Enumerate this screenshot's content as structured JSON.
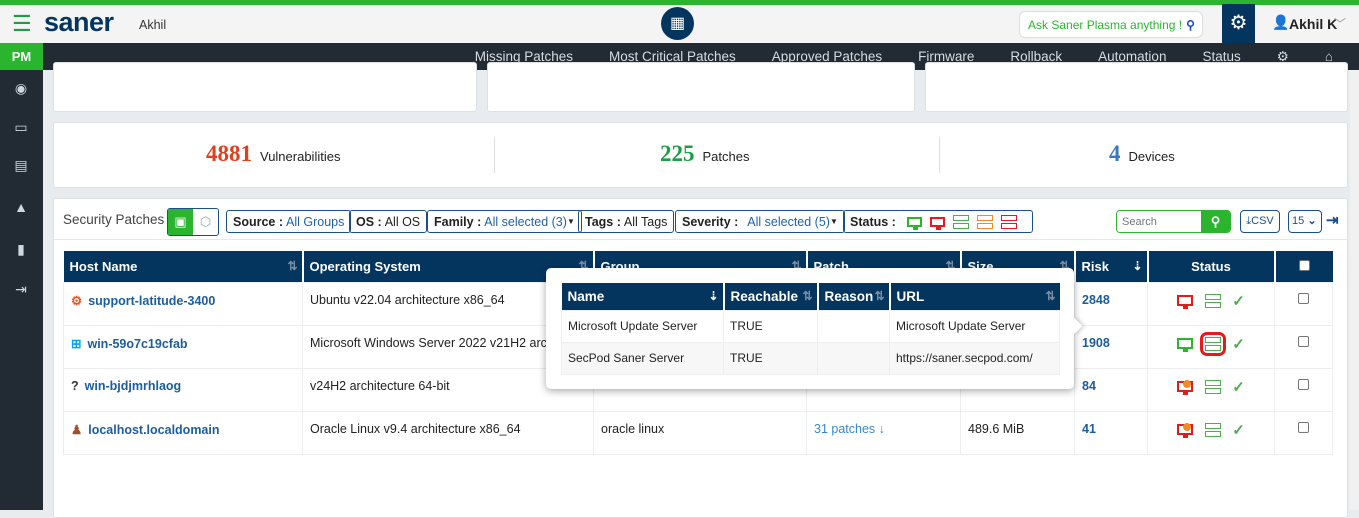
{
  "header": {
    "logo": "saner",
    "account": "Akhil",
    "ask": "Ask Saner Plasma anything !",
    "user": "Akhil K"
  },
  "nav": {
    "module": "PM",
    "items": [
      "Missing Patches",
      "Most Critical Patches",
      "Approved Patches",
      "Firmware",
      "Rollback",
      "Automation",
      "Status"
    ]
  },
  "stats": [
    {
      "value": "4881",
      "label": "Vulnerabilities",
      "color": "#e0401f"
    },
    {
      "value": "225",
      "label": "Patches",
      "color": "#1d9d47"
    },
    {
      "value": "4",
      "label": "Devices",
      "color": "#3a79c0"
    }
  ],
  "toolbar": {
    "title": "Security Patches",
    "source_label": "Source :",
    "source_value": "All Groups",
    "os_label": "OS :",
    "os_value": "All OS",
    "family_label": "Family :",
    "family_value": "All selected (3)",
    "tags_label": "Tags :",
    "tags_value": "All Tags",
    "severity_label": "Severity :",
    "severity_value": "All selected (5)",
    "status_label": "Status :",
    "search_placeholder": "Search",
    "csv": "CSV",
    "page_size": "15"
  },
  "table": {
    "headers": [
      "Host Name",
      "Operating System",
      "Group",
      "Patch",
      "Size",
      "Risk",
      "Status"
    ],
    "rows": [
      {
        "host": "support-latitude-3400",
        "os": "Ubuntu v22.04 architecture x86_64",
        "group": "",
        "patch": "",
        "size": "",
        "risk": "2848",
        "device": "red"
      },
      {
        "host": "win-59o7c19cfab",
        "os": "Microsoft Windows Server 2022 v21H2 architecture",
        "group": "",
        "patch": "",
        "size": "",
        "risk": "1908",
        "device": "green"
      },
      {
        "host": "win-bjdjmrhlaog",
        "os": "v24H2 architecture 64-bit",
        "group": "",
        "patch": "",
        "size": "",
        "risk": "84",
        "device": "warn"
      },
      {
        "host": "localhost.localdomain",
        "os": "Oracle Linux v9.4 architecture x86_64",
        "group": "oracle linux",
        "patch": "31 patches",
        "size": "489.6 MiB",
        "risk": "41",
        "device": "warn"
      }
    ]
  },
  "popup": {
    "headers": [
      "Name",
      "Reachable",
      "Reason",
      "URL"
    ],
    "rows": [
      [
        "Microsoft Update Server",
        "TRUE",
        "",
        "Microsoft Update Server"
      ],
      [
        "SecPod Saner Server",
        "TRUE",
        "",
        "https://saner.secpod.com/"
      ]
    ]
  }
}
